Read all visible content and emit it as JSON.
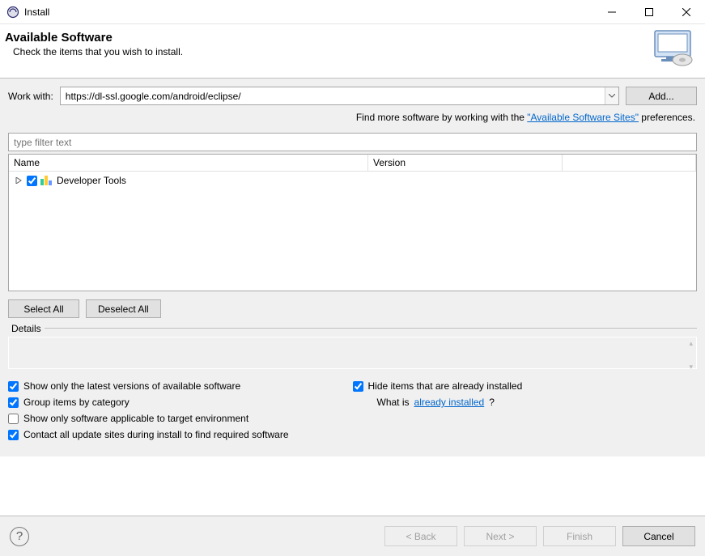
{
  "window": {
    "title": "Install"
  },
  "header": {
    "title": "Available Software",
    "subtitle": "Check the items that you wish to install."
  },
  "workwith": {
    "label": "Work with:",
    "value": "https://dl-ssl.google.com/android/eclipse/",
    "add_button": "Add..."
  },
  "findmore": {
    "prefix": "Find more software by working with the ",
    "link": "\"Available Software Sites\"",
    "suffix": " preferences."
  },
  "filter": {
    "placeholder": "type filter text"
  },
  "tree": {
    "columns": {
      "name": "Name",
      "version": "Version"
    },
    "items": [
      {
        "label": "Developer Tools",
        "checked": true
      }
    ]
  },
  "selection": {
    "select_all": "Select All",
    "deselect_all": "Deselect All"
  },
  "details": {
    "label": "Details"
  },
  "options": {
    "show_latest": {
      "label": "Show only the latest versions of available software",
      "checked": true
    },
    "hide_installed": {
      "label": "Hide items that are already installed",
      "checked": true
    },
    "group_category": {
      "label": "Group items by category",
      "checked": true
    },
    "what_is_prefix": "What is ",
    "what_is_link": "already installed",
    "what_is_suffix": "?",
    "show_applicable": {
      "label": "Show only software applicable to target environment",
      "checked": false
    },
    "contact_sites": {
      "label": "Contact all update sites during install to find required software",
      "checked": true
    }
  },
  "footer": {
    "back": "< Back",
    "next": "Next >",
    "finish": "Finish",
    "cancel": "Cancel"
  }
}
